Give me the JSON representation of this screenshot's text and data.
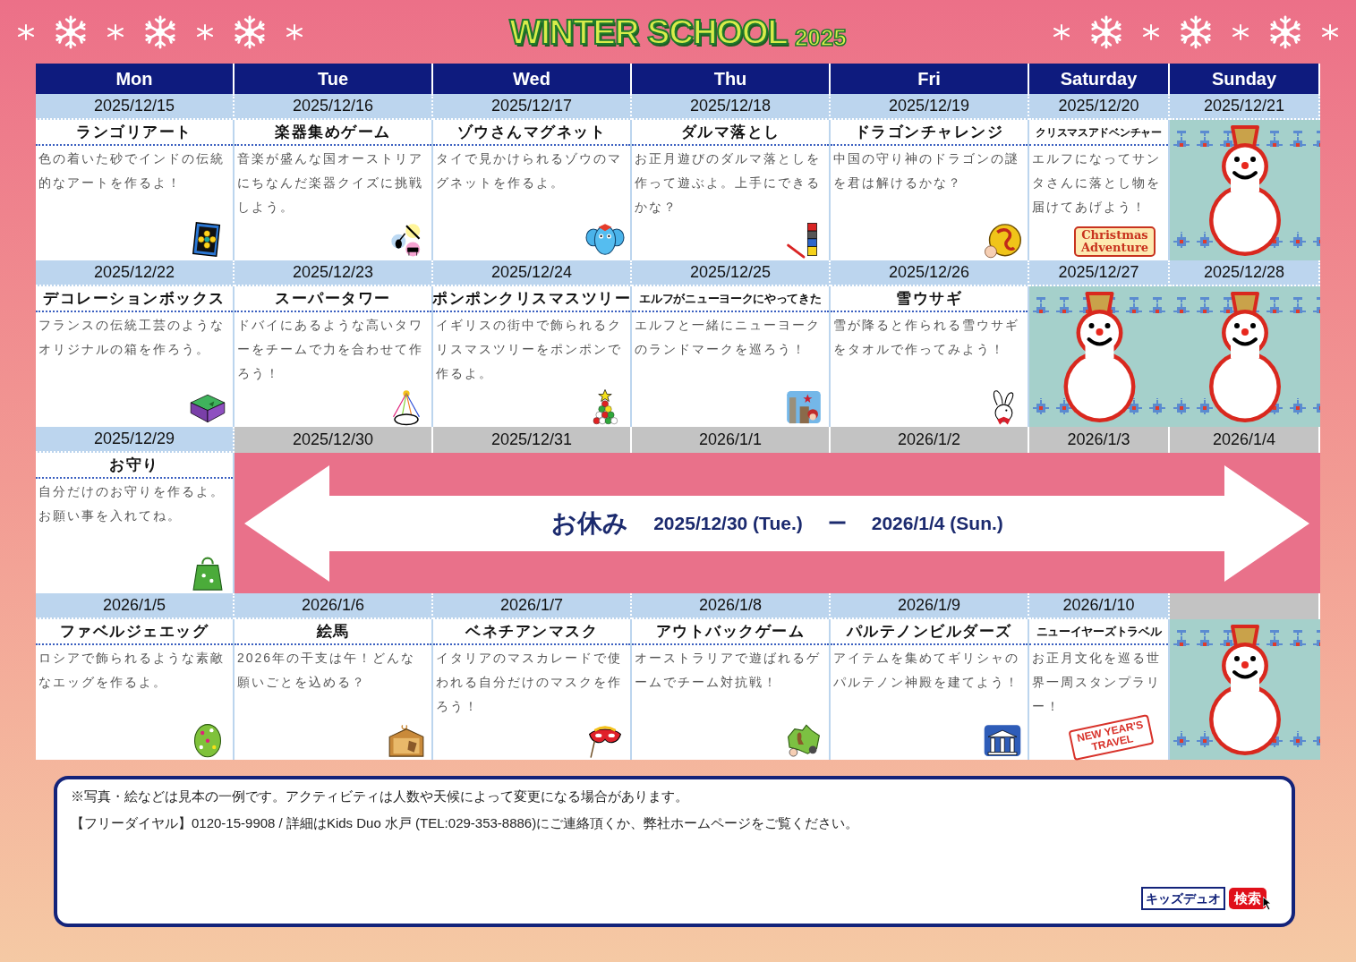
{
  "logo": {
    "title": "WINTER SCHOOL",
    "year": "2025"
  },
  "columns": [
    {
      "label": "Mon"
    },
    {
      "label": "Tue"
    },
    {
      "label": "Wed"
    },
    {
      "label": "Thu"
    },
    {
      "label": "Fri"
    },
    {
      "label": "Saturday"
    },
    {
      "label": "Sunday"
    }
  ],
  "weeks": [
    {
      "days": [
        {
          "kind": "activity",
          "date": "2025/12/15",
          "title": "ランゴリアート",
          "description": "色の着いた砂でインドの伝統的なアートを作るよ！"
        },
        {
          "kind": "activity",
          "date": "2025/12/16",
          "title": "楽器集めゲーム",
          "description": "音楽が盛んな国オーストリアにちなんだ楽器クイズに挑戦しよう。"
        },
        {
          "kind": "activity",
          "date": "2025/12/17",
          "title": "ゾウさんマグネット",
          "description": "タイで見かけられるゾウのマグネットを作るよ。"
        },
        {
          "kind": "activity",
          "date": "2025/12/18",
          "title": "ダルマ落とし",
          "description": "お正月遊びのダルマ落としを作って遊ぶよ。上手にできるかな？"
        },
        {
          "kind": "activity",
          "date": "2025/12/19",
          "title": "ドラゴンチャレンジ",
          "description": "中国の守り神のドラゴンの謎を君は解けるかな？"
        },
        {
          "kind": "activity",
          "date": "2025/12/20",
          "title": "クリスマスアドベンチャー",
          "description": "エルフになってサンタさんに落とし物を届けてあげよう！",
          "sign": {
            "kind": "sign",
            "text": "Christmas\nAdventure"
          }
        },
        {
          "kind": "snowman",
          "date": "2025/12/21"
        }
      ]
    },
    {
      "days": [
        {
          "kind": "activity",
          "date": "2025/12/22",
          "title": "デコレーションボックス",
          "description": "フランスの伝統工芸のようなオリジナルの箱を作ろう。"
        },
        {
          "kind": "activity",
          "date": "2025/12/23",
          "title": "スーパータワー",
          "description": "ドバイにあるような高いタワーをチームで力を合わせて作ろう！"
        },
        {
          "kind": "activity",
          "date": "2025/12/24",
          "title": "ポンポンクリスマスツリー",
          "description": "イギリスの街中で飾られるクリスマスツリーをポンポンで作るよ。"
        },
        {
          "kind": "activity",
          "date": "2025/12/25",
          "title": "エルフがニューヨークにやってきた",
          "description": "エルフと一緒にニューヨークのランドマークを巡ろう！"
        },
        {
          "kind": "activity",
          "date": "2025/12/26",
          "title": "雪ウサギ",
          "description": "雪が降ると作られる雪ウサギをタオルで作ってみよう！"
        },
        {
          "kind": "snowman",
          "date": "2025/12/27"
        },
        {
          "kind": "snowman",
          "date": "2025/12/28"
        }
      ]
    },
    {
      "days": [
        {
          "kind": "activity",
          "date": "2025/12/29",
          "title": "お守り",
          "description": "自分だけのお守りを作るよ。お願い事を入れてね。"
        },
        {
          "kind": "holiday",
          "date": "2025/12/30"
        },
        {
          "kind": "holiday",
          "date": "2025/12/31"
        },
        {
          "kind": "holiday",
          "date": "2026/1/1"
        },
        {
          "kind": "holiday",
          "date": "2026/1/2"
        },
        {
          "kind": "holiday",
          "date": "2026/1/3"
        },
        {
          "kind": "holiday",
          "date": "2026/1/4"
        }
      ],
      "holiday": {
        "label": "お休み",
        "range_start": "2025/12/30 (Tue.)",
        "dash": "ー",
        "range_end": "2026/1/4 (Sun.)"
      }
    },
    {
      "days": [
        {
          "kind": "activity",
          "date": "2026/1/5",
          "title": "ファベルジェエッグ",
          "description": "ロシアで飾られるような素敵なエッグを作るよ。"
        },
        {
          "kind": "activity",
          "date": "2026/1/6",
          "title": "絵馬",
          "description": "2026年の干支は午！どんな願いごとを込める？"
        },
        {
          "kind": "activity",
          "date": "2026/1/7",
          "title": "ベネチアンマスク",
          "description": "イタリアのマスカレードで使われる自分だけのマスクを作ろう！"
        },
        {
          "kind": "activity",
          "date": "2026/1/8",
          "title": "アウトバックゲーム",
          "description": "オーストラリアで遊ばれるゲームでチーム対抗戦！"
        },
        {
          "kind": "activity",
          "date": "2026/1/9",
          "title": "パルテノンビルダーズ",
          "description": "アイテムを集めてギリシャのパルテノン神殿を建てよう！"
        },
        {
          "kind": "activity",
          "date": "2026/1/10",
          "title": "ニューイヤーズトラベル",
          "description": "お正月文化を巡る世界一周スタンプラリー！",
          "sign": {
            "kind": "stamp",
            "text": "NEW YEAR'S\nTRAVEL"
          }
        },
        {
          "kind": "snowman"
        }
      ]
    }
  ],
  "notes": [
    "※写真・絵などは見本の一例です。アクティビティは人数や天候によって変更になる場合があります。",
    "【フリーダイヤル】0120-15-9908 / 詳細はKids Duo 水戸 (TEL:029-353-8886)にご連絡頂くか、弊社ホームページをご覧ください。"
  ],
  "search": {
    "query": "キッズデュオ",
    "button": "検索"
  }
}
